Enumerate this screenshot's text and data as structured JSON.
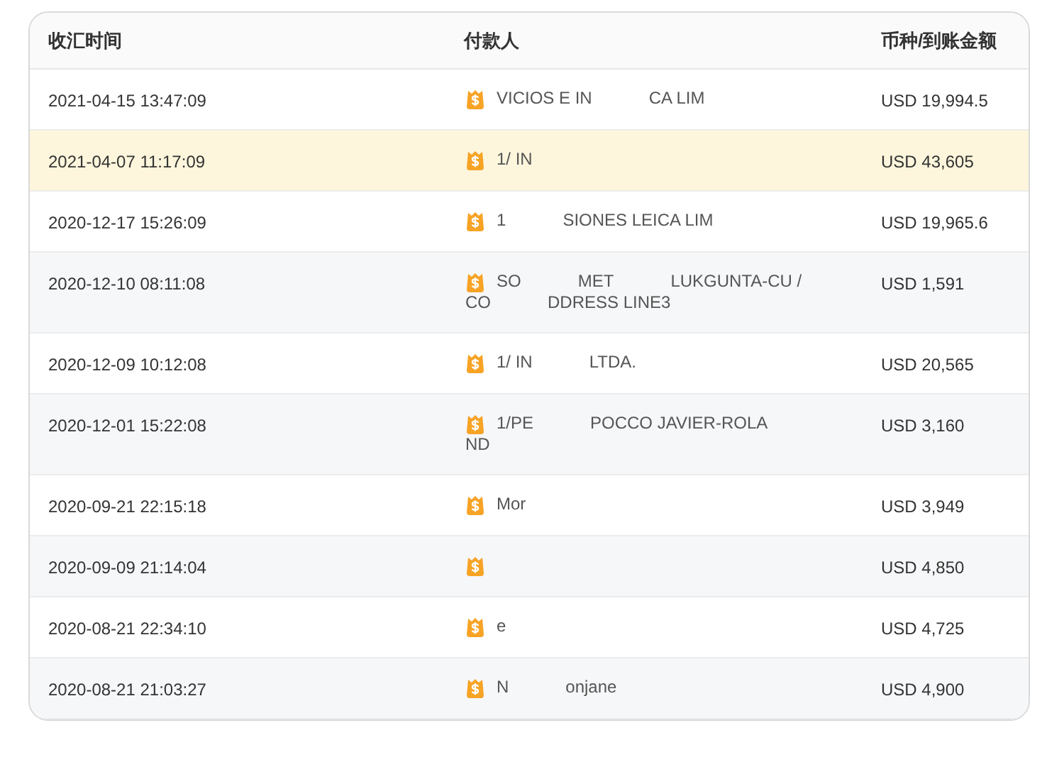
{
  "table": {
    "columns": [
      "收汇时间",
      "付款人",
      "币种/到账金额"
    ],
    "rows": [
      {
        "time": "2021-04-15 13:47:09",
        "payer": [
          [
            "VICIOS E IN",
            "CA LIM"
          ]
        ],
        "amount": "USD 19,994.5",
        "selected": false
      },
      {
        "time": "2021-04-07 11:17:09",
        "payer": [
          [
            "1/ IN"
          ]
        ],
        "amount": "USD 43,605",
        "selected": true
      },
      {
        "time": "2020-12-17 15:26:09",
        "payer": [
          [
            "1",
            "SIONES LEICA LIM"
          ]
        ],
        "amount": "USD 19,965.6",
        "selected": false
      },
      {
        "time": "2020-12-10 08:11:08",
        "payer": [
          [
            "SO",
            "MET",
            "LUKGUNTA-CU /"
          ],
          [
            "CO",
            "DDRESS LINE3"
          ]
        ],
        "amount": "USD 1,591",
        "selected": false
      },
      {
        "time": "2020-12-09 10:12:08",
        "payer": [
          [
            "1/ IN",
            "LTDA."
          ]
        ],
        "amount": "USD 20,565",
        "selected": false
      },
      {
        "time": "2020-12-01 15:22:08",
        "payer": [
          [
            "1/PE",
            "POCCO JAVIER-ROLA"
          ],
          [
            "ND"
          ]
        ],
        "amount": "USD 3,160",
        "selected": false
      },
      {
        "time": "2020-09-21 22:15:18",
        "payer": [
          [
            "Mor"
          ]
        ],
        "amount": "USD 3,949",
        "selected": false
      },
      {
        "time": "2020-09-09 21:14:04",
        "amount": "USD 4,850",
        "selected": false
      },
      {
        "time": "2020-08-21 22:34:10",
        "payer": [
          [
            "e"
          ]
        ],
        "amount": "USD 4,725",
        "selected": false
      },
      {
        "time": "2020-08-21 21:03:27",
        "payer": [
          [
            "N",
            "onjane"
          ]
        ],
        "amount": "USD 4,900",
        "selected": false
      }
    ]
  }
}
